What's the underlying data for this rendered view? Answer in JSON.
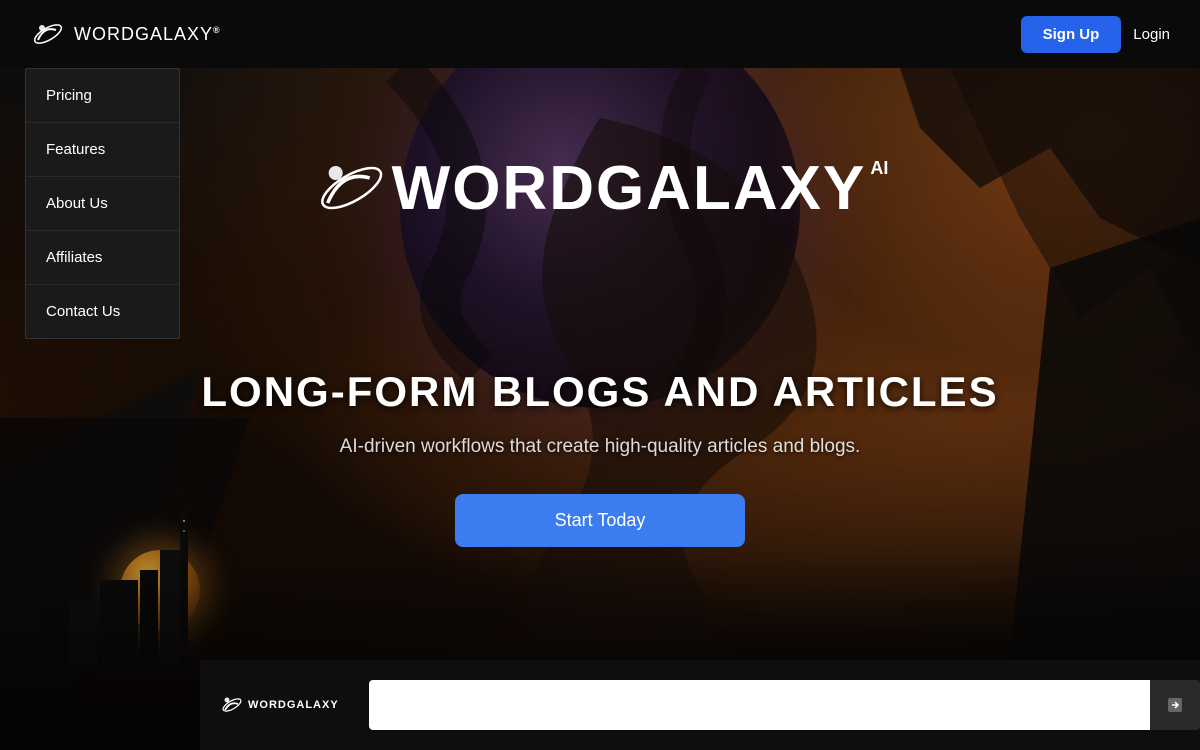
{
  "navbar": {
    "logo_word": "WORD",
    "logo_galaxy": "GALAXY",
    "logo_trademark": "®",
    "signup_label": "Sign Up",
    "login_label": "Login"
  },
  "dropdown": {
    "items": [
      {
        "id": "pricing",
        "label": "Pricing"
      },
      {
        "id": "features",
        "label": "Features"
      },
      {
        "id": "about-us",
        "label": "About Us"
      },
      {
        "id": "affiliates",
        "label": "Affiliates"
      },
      {
        "id": "contact-us",
        "label": "Contact Us"
      }
    ]
  },
  "hero": {
    "logo_word": "WORD",
    "logo_galaxy": "GALAXY",
    "logo_ai": "AI",
    "title": "LONG-FORM BLOGS AND ARTICLES",
    "subtitle": "AI-driven workflows that create high-quality articles and blogs.",
    "cta_label": "Start Today"
  },
  "bottom": {
    "logo_text": "WORDGALAXY"
  }
}
